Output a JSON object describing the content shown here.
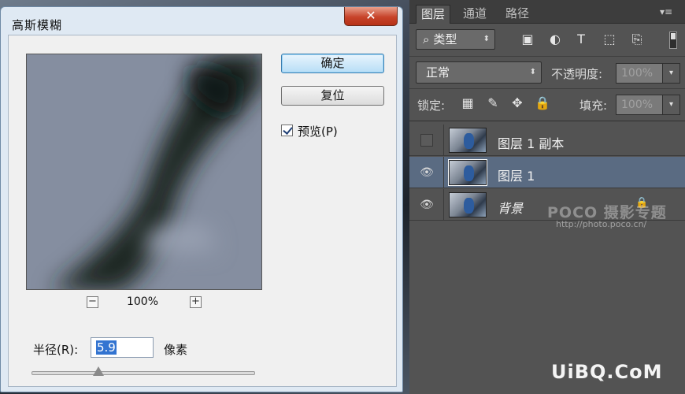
{
  "dialog": {
    "title": "高斯模糊",
    "close_glyph": "✕",
    "ok_label": "确定",
    "reset_label": "复位",
    "preview_label": "预览(P)",
    "preview_checked": true,
    "zoom_out_glyph": "−",
    "zoom_in_glyph": "+",
    "zoom_level": "100%",
    "radius_label": "半径(R):",
    "radius_value": "5.9",
    "radius_unit": "像素",
    "slider_position": 0.3
  },
  "panel": {
    "tabs": [
      {
        "label": "图层",
        "active": true
      },
      {
        "label": "通道",
        "active": false
      },
      {
        "label": "路径",
        "active": false
      }
    ],
    "menu_icon": "▾≡",
    "filter": {
      "search_glyph": "⌕",
      "label": "类型",
      "arrow": "⬍",
      "icons": [
        "image-filter-icon",
        "adjustment-filter-icon",
        "type-filter-icon",
        "shape-filter-icon",
        "smart-object-filter-icon"
      ],
      "icon_glyphs": [
        "▣",
        "◐",
        "T",
        "⬚",
        "⎘"
      ]
    },
    "blend_mode": "正常",
    "opacity_label": "不透明度:",
    "opacity_value": "100%",
    "lock_label": "锁定:",
    "lock_icon_glyphs": [
      "▦",
      "✎",
      "✥",
      "🔒"
    ],
    "fill_label": "填充:",
    "fill_value": "100%",
    "dropdown_glyph": "▾",
    "layers": [
      {
        "name": "图层 1 副本",
        "visible": false,
        "selected": false,
        "italic": false,
        "locked": false
      },
      {
        "name": "图层 1",
        "visible": true,
        "selected": true,
        "italic": false,
        "locked": false
      },
      {
        "name": "背景",
        "visible": true,
        "selected": false,
        "italic": true,
        "locked": true
      }
    ],
    "eye_glyph": "👁",
    "lock_glyph": "🔒"
  },
  "watermarks": {
    "poco": "POCO 摄影专题",
    "poco_url": "http://photo.poco.cn/",
    "uibq": "UiBQ.CoM"
  },
  "colors": {
    "selected_layer": "#5a6b82",
    "panel_bg": "#535353",
    "ok_button": "#b7def6",
    "radius_highlight": "#3374d1"
  }
}
